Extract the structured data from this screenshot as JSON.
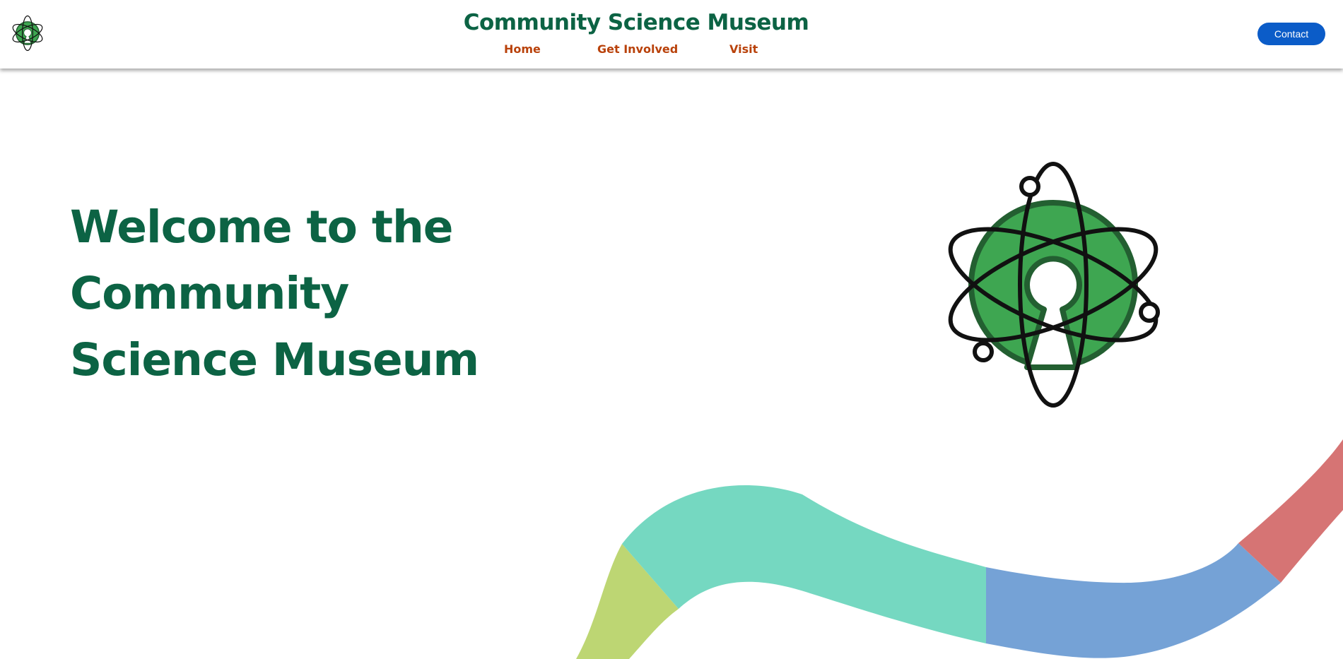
{
  "header": {
    "site_title": "Community Science Museum",
    "logo_icon": "atom-keyhole-logo-icon",
    "nav": [
      {
        "label": "Home"
      },
      {
        "label": "Get Involved"
      },
      {
        "label": "Visit"
      }
    ],
    "contact_label": "Contact"
  },
  "hero": {
    "heading_lines": [
      "Welcome to the",
      "Community",
      "Science Museum"
    ],
    "logo_icon": "atom-keyhole-logo-icon"
  },
  "colors": {
    "brand_green": "#0c6344",
    "nav_orange": "#b9420b",
    "contact_blue": "#0b5cc8",
    "logo_green": "#3ea651",
    "logo_dark_green": "#235f31",
    "wave_lime": "#bdd673",
    "wave_teal": "#75d8c1",
    "wave_blue": "#75a2d6",
    "wave_red": "#d67474"
  }
}
